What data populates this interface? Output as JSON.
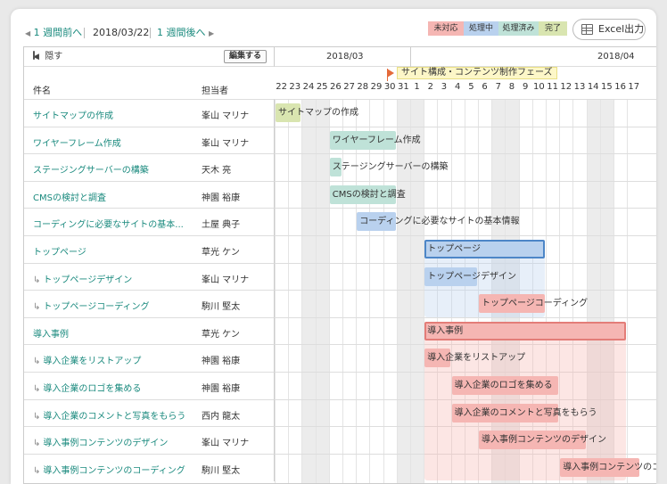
{
  "nav": {
    "prev_label": "1 週間前へ",
    "current_date": "2018/03/22",
    "next_label": "1 週間後へ",
    "prev_icon": "triangle-left-icon",
    "next_icon": "triangle-right-icon"
  },
  "legend": [
    {
      "label": "未対応",
      "color": "#f5b6b3"
    },
    {
      "label": "処理中",
      "color": "#b9d1ee"
    },
    {
      "label": "処理済み",
      "color": "#bfe2d8"
    },
    {
      "label": "完了",
      "color": "#d9e5b0"
    }
  ],
  "excel_button": {
    "label": "Excel出力",
    "icon": "table-icon"
  },
  "left_header": {
    "hide_label": "隠す",
    "hide_icon": "collapse-left-icon",
    "edit_label": "編集する",
    "col_name": "件名",
    "col_assignee": "担当者"
  },
  "months": [
    "2018/03",
    "2018/04"
  ],
  "days": [
    "22",
    "23",
    "24",
    "25",
    "26",
    "27",
    "28",
    "29",
    "30",
    "31",
    "1",
    "2",
    "3",
    "4",
    "5",
    "6",
    "7",
    "8",
    "9",
    "10",
    "11",
    "12",
    "13",
    "14",
    "15",
    "16",
    "17"
  ],
  "weekend_days": [
    2,
    3,
    9,
    10,
    16,
    17,
    23,
    24
  ],
  "phase": {
    "label": "サイト構成・コンテンツ制作フェーズ",
    "color": "#fdf7c8",
    "flag_color": "#e46a3a"
  },
  "rows": [
    {
      "name": "サイトマップの作成",
      "assignee": "峯山 マリナ",
      "child": false,
      "bar_label": "サイトマップの作成",
      "status": "完了",
      "start": 0,
      "length": 2
    },
    {
      "name": "ワイヤーフレーム作成",
      "assignee": "峯山 マリナ",
      "child": false,
      "bar_label": "ワイヤーフレーム作成",
      "status": "処理済み",
      "start": 4,
      "length": 5
    },
    {
      "name": "ステージングサーバーの構築",
      "assignee": "天木 亮",
      "child": false,
      "bar_label": "ステージングサーバーの構築",
      "status": "処理済み",
      "start": 4,
      "length": 1
    },
    {
      "name": "CMSの検討と調査",
      "assignee": "神園 裕康",
      "child": false,
      "bar_label": "CMSの検討と調査",
      "status": "処理済み",
      "start": 4,
      "length": 5
    },
    {
      "name": "コーディングに必要なサイトの基本...",
      "assignee": "土屋 典子",
      "child": false,
      "bar_label": "コーディングに必要なサイトの基本情報",
      "status": "処理中",
      "start": 6,
      "length": 3
    },
    {
      "name": "トップページ",
      "assignee": "草光 ケン",
      "child": false,
      "bar_label": "トップページ",
      "status": "処理中",
      "start": 11,
      "length": 9,
      "parent": true
    },
    {
      "name": "トップページデザイン",
      "assignee": "峯山 マリナ",
      "child": true,
      "bar_label": "トップページデザイン",
      "status": "処理中",
      "start": 11,
      "length": 4
    },
    {
      "name": "トップページコーディング",
      "assignee": "駒川 堅太",
      "child": true,
      "bar_label": "トップページコーディング",
      "status": "未対応",
      "start": 15,
      "length": 5
    },
    {
      "name": "導入事例",
      "assignee": "草光 ケン",
      "child": false,
      "bar_label": "導入事例",
      "status": "未対応",
      "start": 11,
      "length": 15,
      "parent": true
    },
    {
      "name": "導入企業をリストアップ",
      "assignee": "神園 裕康",
      "child": true,
      "bar_label": "導入企業をリストアップ",
      "status": "未対応",
      "start": 11,
      "length": 2
    },
    {
      "name": "導入企業のロゴを集める",
      "assignee": "神園 裕康",
      "child": true,
      "bar_label": "導入企業のロゴを集める",
      "status": "未対応",
      "start": 13,
      "length": 8
    },
    {
      "name": "導入企業のコメントと写真をもらう",
      "assignee": "西内 龍太",
      "child": true,
      "bar_label": "導入企業のコメントと写真をもらう",
      "status": "未対応",
      "start": 13,
      "length": 8
    },
    {
      "name": "導入事例コンテンツのデザイン",
      "assignee": "峯山 マリナ",
      "child": true,
      "bar_label": "導入事例コンテンツのデザイン",
      "status": "未対応",
      "start": 15,
      "length": 8
    },
    {
      "name": "導入事例コンテンツのコーディング",
      "assignee": "駒川 堅太",
      "child": true,
      "bar_label": "導入事例コンテンツのコーディング",
      "status": "未対応",
      "start": 21,
      "length": 6
    }
  ]
}
